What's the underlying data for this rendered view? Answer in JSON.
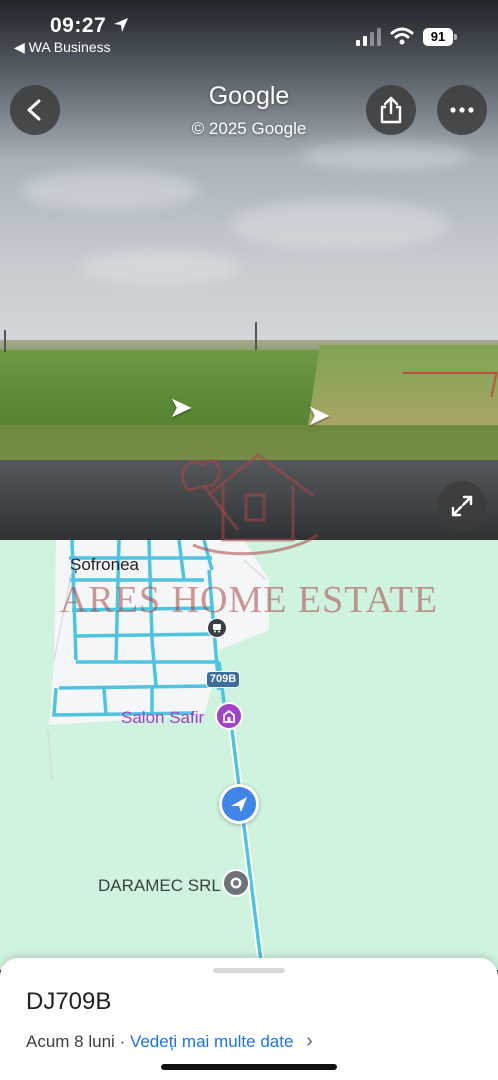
{
  "status_bar": {
    "time": "09:27",
    "back_app": "◀ WA Business",
    "battery": "91"
  },
  "header": {
    "title": "Google",
    "copyright": "© 2025 Google"
  },
  "map": {
    "village_label": "Șofronea",
    "road_badge": "709B",
    "poi_salon": "Salon Safir",
    "poi_daramec": "DARAMEC SRL"
  },
  "watermark": {
    "text": "ARES HOME ESTATE"
  },
  "sheet": {
    "title": "DJ709B",
    "time_ago": "Acum 8 luni",
    "separator": " · ",
    "more_link": "Vedeți mai multe date",
    "chevron": "›"
  },
  "colors": {
    "map_bg": "#cff3df",
    "street_line": "#4fc3e0",
    "accent": "#1a73e8",
    "pin_salon": "#a142c9",
    "pin_daramec": "#6e7378",
    "me_pin": "#3f86e8"
  },
  "icons": [
    "back-chevron-icon",
    "share-icon",
    "more-icon",
    "expand-icon",
    "location-arrow-icon",
    "signal-icon",
    "wifi-icon",
    "battery-icon",
    "salon-pin-icon",
    "place-pin-icon",
    "bus-stop-icon",
    "navigation-arrow-icon",
    "chevron-right-icon"
  ]
}
